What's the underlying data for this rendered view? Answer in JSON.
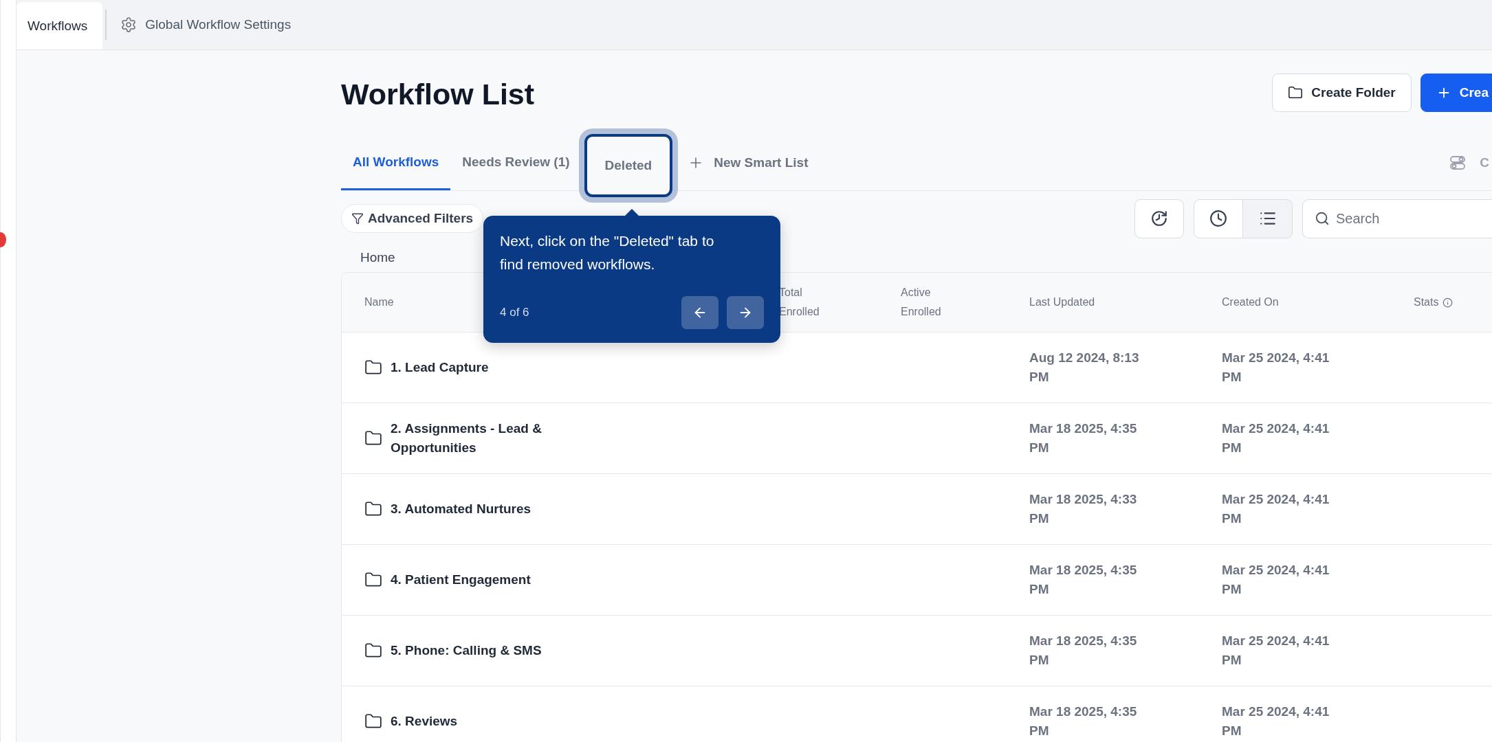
{
  "top_tabs": [
    {
      "label": "Workflows",
      "selected": true,
      "kind": "plain"
    },
    {
      "label": "Global Workflow Settings",
      "selected": false,
      "kind": "settings"
    }
  ],
  "title": "Workflow List",
  "header_buttons": [
    {
      "label": "Create Folder",
      "kind": "folder"
    },
    {
      "label": "Crea",
      "kind": "primary"
    }
  ],
  "tabs": [
    {
      "label": "All Workflows",
      "selected": true,
      "spotlight": false
    },
    {
      "label": "Needs Review (1)",
      "selected": false,
      "spotlight": false
    },
    {
      "label": "Deleted",
      "selected": false,
      "spotlight": true
    }
  ],
  "new_smart_list": "New Smart List",
  "right_tab_label": "C",
  "advanced_filters": "Advanced Filters",
  "search": {
    "placeholder": "Search"
  },
  "breadcrumb": "Home",
  "table": {
    "columns": [
      "Name",
      "Total Enrolled",
      "Active Enrolled",
      "Last Updated",
      "Created On",
      "Stats"
    ],
    "rows": [
      {
        "name": "1. Lead Capture",
        "last_updated": "Aug 12 2024, 8:13 PM",
        "created_on": "Mar 25 2024, 4:41 PM"
      },
      {
        "name": "2. Assignments - Lead & Opportunities",
        "last_updated": "Mar 18 2025, 4:35 PM",
        "created_on": "Mar 25 2024, 4:41 PM"
      },
      {
        "name": "3. Automated Nurtures",
        "last_updated": "Mar 18 2025, 4:33 PM",
        "created_on": "Mar 25 2024, 4:41 PM"
      },
      {
        "name": "4. Patient Engagement",
        "last_updated": "Mar 18 2025, 4:35 PM",
        "created_on": "Mar 25 2024, 4:41 PM"
      },
      {
        "name": "5. Phone: Calling & SMS",
        "last_updated": "Mar 18 2025, 4:35 PM",
        "created_on": "Mar 25 2024, 4:41 PM"
      },
      {
        "name": "6. Reviews",
        "last_updated": "Mar 18 2025, 4:35 PM",
        "created_on": "Mar 25 2024, 4:41 PM"
      }
    ]
  },
  "tour": {
    "text": "Next, click on the \"Deleted\" tab to find removed workflows.",
    "step": "4 of 6"
  }
}
